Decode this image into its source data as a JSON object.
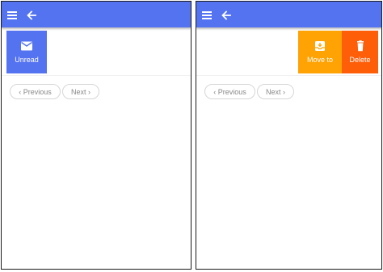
{
  "colors": {
    "topbar": "#5473f0",
    "unread": "#5473f0",
    "move_to": "#ffa203",
    "delete": "#ff5e09",
    "pager_text": "#888888"
  },
  "left_panel": {
    "icons": [
      "hamburger-menu-icon",
      "arrow-left-icon",
      "envelope-icon"
    ],
    "action": {
      "label": "Unread",
      "icon": "envelope-icon"
    },
    "pager": {
      "previous": "‹ Previous",
      "next": "Next ›"
    }
  },
  "right_panel": {
    "icons": [
      "hamburger-menu-icon",
      "arrow-left-icon",
      "archive-icon",
      "trash-icon"
    ],
    "actions": [
      {
        "label": "Move to",
        "icon": "archive-icon"
      },
      {
        "label": "Delete",
        "icon": "trash-icon"
      }
    ],
    "pager": {
      "previous": "‹ Previous",
      "next": "Next ›"
    }
  }
}
